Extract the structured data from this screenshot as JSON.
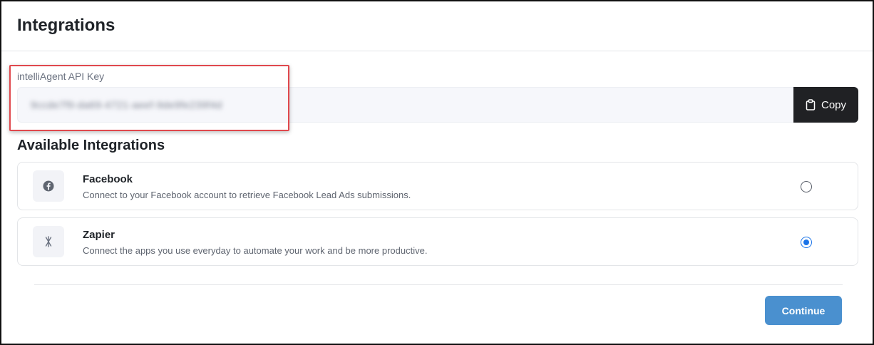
{
  "header": {
    "title": "Integrations"
  },
  "api_key": {
    "label": "intelliAgent API Key",
    "value": "9ccde7f9-da69-4721-aeef-9de9fe239f4d",
    "copy_label": "Copy"
  },
  "integrations": {
    "title": "Available Integrations",
    "items": [
      {
        "name": "Facebook",
        "description": "Connect to your Facebook account to retrieve Facebook Lead Ads submissions.",
        "icon": "facebook-icon",
        "selected": false
      },
      {
        "name": "Zapier",
        "description": "Connect the apps you use everyday to automate your work and be more productive.",
        "icon": "zapier-icon",
        "selected": true
      }
    ]
  },
  "footer": {
    "continue_label": "Continue"
  },
  "colors": {
    "primary_button": "#4a90cf",
    "copy_button": "#202124",
    "radio_selected": "#1a73e8",
    "highlight": "#e0484d"
  }
}
